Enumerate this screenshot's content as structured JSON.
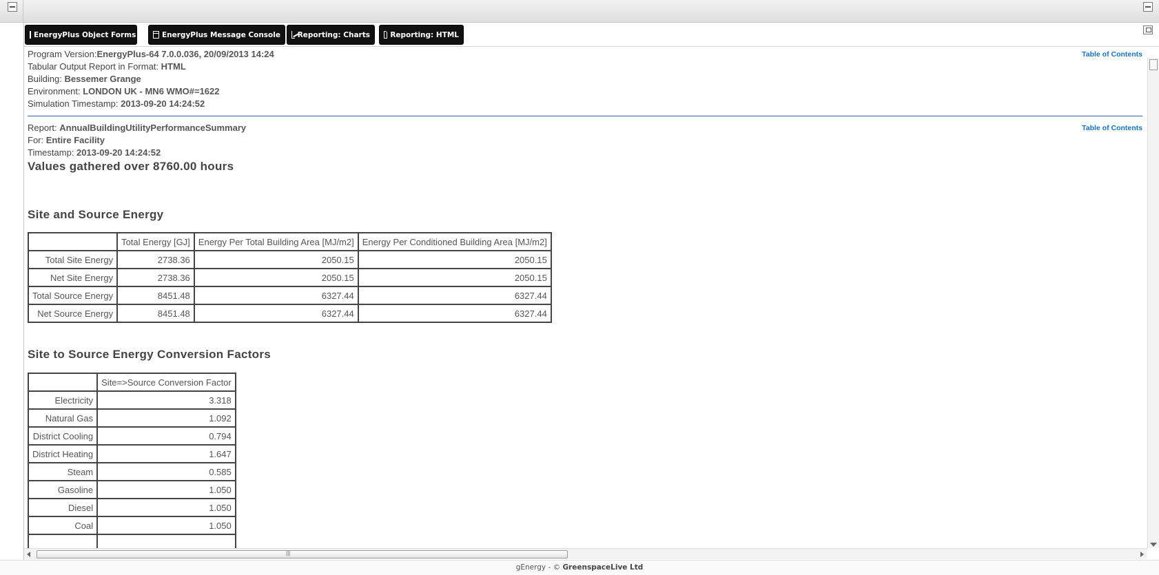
{
  "window": {
    "minimize_left_label": "",
    "minimize_right_label": ""
  },
  "toolbar": {
    "buttons": [
      {
        "label": "EnergyPlus Object Forms",
        "icon": "form-icon"
      },
      {
        "label": "EnergyPlus Message Console",
        "icon": "console-icon"
      },
      {
        "label": "Reporting: Charts",
        "icon": "chart-icon"
      },
      {
        "label": "Reporting: HTML",
        "icon": "html-document-icon"
      }
    ]
  },
  "header": {
    "toc_label": "Table of Contents",
    "program_version_label": "Program Version:",
    "program_version": "EnergyPlus-64 7.0.0.036, 20/09/2013 14:24",
    "format_label": "Tabular Output Report in Format: ",
    "format": "HTML",
    "building_label": "Building: ",
    "building": "Bessemer Grange",
    "environment_label": "Environment: ",
    "environment": "LONDON UK - MN6 WMO#=1622",
    "sim_timestamp_label": "Simulation Timestamp: ",
    "sim_timestamp": "2013-09-20 14:24:52"
  },
  "report": {
    "toc_label": "Table of Contents",
    "report_label": "Report: ",
    "report_name": "AnnualBuildingUtilityPerformanceSummary",
    "for_label": "For: ",
    "for_value": "Entire Facility",
    "timestamp_label": "Timestamp: ",
    "timestamp": "2013-09-20 14:24:52",
    "values_gathered": "Values gathered over 8760.00 hours"
  },
  "site_source": {
    "title": "Site and Source Energy",
    "columns": [
      "",
      "Total Energy [GJ]",
      "Energy Per Total Building Area [MJ/m2]",
      "Energy Per Conditioned Building Area [MJ/m2]"
    ],
    "rows": [
      [
        "Total Site Energy",
        "2738.36",
        "2050.15",
        "2050.15"
      ],
      [
        "Net Site Energy",
        "2738.36",
        "2050.15",
        "2050.15"
      ],
      [
        "Total Source Energy",
        "8451.48",
        "6327.44",
        "6327.44"
      ],
      [
        "Net Source Energy",
        "8451.48",
        "6327.44",
        "6327.44"
      ]
    ]
  },
  "conversion": {
    "title": "Site to Source Energy Conversion Factors",
    "columns": [
      "",
      "Site=>Source Conversion Factor"
    ],
    "rows": [
      [
        "Electricity",
        "3.318"
      ],
      [
        "Natural Gas",
        "1.092"
      ],
      [
        "District Cooling",
        "0.794"
      ],
      [
        "District Heating",
        "1.647"
      ],
      [
        "Steam",
        "0.585"
      ],
      [
        "Gasoline",
        "1.050"
      ],
      [
        "Diesel",
        "1.050"
      ],
      [
        "Coal",
        "1.050"
      ],
      [
        "",
        ""
      ]
    ]
  },
  "footer": {
    "prefix": "gEnergy - © ",
    "company": "GreenspaceLive Ltd"
  }
}
